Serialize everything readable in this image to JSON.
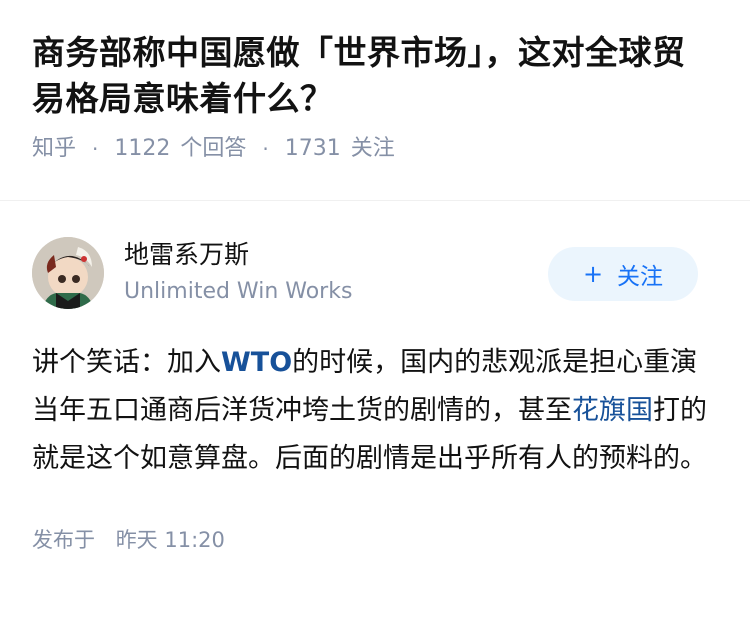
{
  "question": {
    "title": "商务部称中国愿做「世界市场」，这对全球贸易格局意味着什么？",
    "source": "知乎",
    "answers_count": "1122",
    "answers_label": "个回答",
    "followers_count": "1731",
    "followers_label": "关注"
  },
  "answer": {
    "author_name": "地雷系万斯",
    "author_bio": "Unlimited Win Works",
    "follow_button": "关注",
    "follow_icon": "plus-icon",
    "body": {
      "p1_a": "讲个笑话：加入",
      "p1_wto": "WTO",
      "p1_b": "的时候，国内的悲观派是担心重演当年五口通商后洋货冲垮土货的剧情的，甚至",
      "p1_link": "花旗国",
      "p1_c": "打的就是这个如意算盘。后面的剧情是出乎所有人的预料的。"
    },
    "published_label": "发布于",
    "published_time": "昨天 11:20"
  },
  "colors": {
    "link": "#175199",
    "meta": "#8590a6",
    "follow_bg": "#ebf5fd",
    "follow_text": "#1772f6"
  }
}
